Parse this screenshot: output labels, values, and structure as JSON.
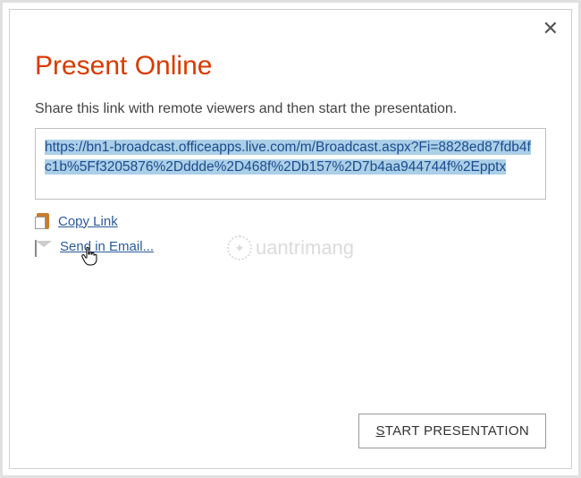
{
  "dialog": {
    "title": "Present Online",
    "instruction": "Share this link with remote viewers and then start the presentation.",
    "url": "https://bn1-broadcast.officeapps.live.com/m/Broadcast.aspx?Fi=8828ed87fdb4fc1b%5Ff3205876%2Dddde%2D468f%2Db157%2D7b4aa944744f%2Epptx",
    "copy_link_label": "Copy Link",
    "send_email_label": "Send in Email...",
    "start_button_prefix": "S",
    "start_button_suffix": "TART PRESENTATION"
  },
  "watermark": {
    "text": "uantrimang"
  }
}
